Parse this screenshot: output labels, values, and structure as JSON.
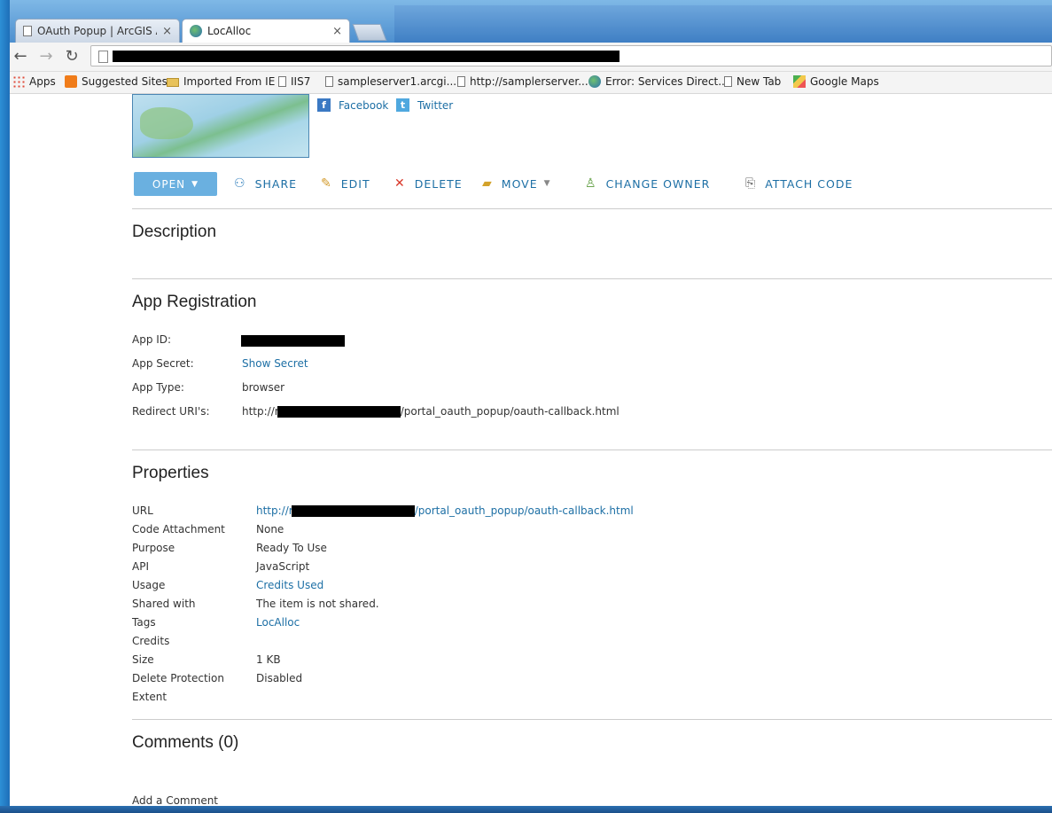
{
  "browser": {
    "tabs": [
      {
        "title": "OAuth Popup | ArcGIS API",
        "close": "×"
      },
      {
        "title": "LocAlloc",
        "close": "×"
      }
    ],
    "nav": {
      "back": "←",
      "forward": "→",
      "reload": "↻"
    },
    "bookmarks": [
      "Apps",
      "Suggested Sites",
      "Imported From IE",
      "IIS7",
      "sampleserver1.arcgi...",
      "http://samplerserver...",
      "Error: Services Direct...",
      "New Tab",
      "Google Maps"
    ]
  },
  "social": {
    "facebook": "Facebook",
    "twitter": "Twitter"
  },
  "actions": {
    "open": "OPEN",
    "share": "SHARE",
    "edit": "EDIT",
    "delete": "DELETE",
    "move": "MOVE",
    "change_owner": "CHANGE OWNER",
    "attach_code": "ATTACH CODE"
  },
  "description": {
    "heading": "Description"
  },
  "app_registration": {
    "heading": "App Registration",
    "app_id_label": "App ID:",
    "app_secret_label": "App Secret:",
    "app_secret_link": "Show Secret",
    "app_type_label": "App Type:",
    "app_type_value": "browser",
    "redirect_label": "Redirect URI's:",
    "redirect_prefix": "http://r",
    "redirect_suffix": "/portal_oauth_popup/oauth-callback.html"
  },
  "properties": {
    "heading": "Properties",
    "url_label": "URL",
    "url_prefix": "http://r",
    "url_suffix": "/portal_oauth_popup/oauth-callback.html",
    "rows": [
      {
        "label": "Code Attachment",
        "value": "None"
      },
      {
        "label": "Purpose",
        "value": "Ready To Use"
      },
      {
        "label": "API",
        "value": "JavaScript"
      },
      {
        "label": "Usage",
        "value": "Credits Used"
      },
      {
        "label": "Shared with",
        "value": "The item is not shared."
      },
      {
        "label": "Tags",
        "value": "LocAlloc"
      },
      {
        "label": "Credits",
        "value": ""
      },
      {
        "label": "Size",
        "value": "1 KB"
      },
      {
        "label": "Delete Protection",
        "value": "Disabled"
      },
      {
        "label": "Extent",
        "value": ""
      }
    ]
  },
  "comments": {
    "heading": "Comments (0)",
    "add": "Add a Comment"
  }
}
